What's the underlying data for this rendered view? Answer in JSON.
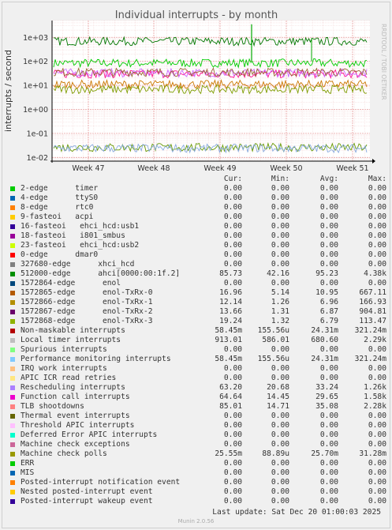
{
  "chart_data": {
    "type": "line",
    "title": "Individual interrupts - by month",
    "ylabel": "interrupts / second",
    "yscale": "log",
    "ylim": [
      0.007,
      5000
    ],
    "yticks": [
      "1e-02",
      "1e-01",
      "1e+00",
      "1e+01",
      "1e+02",
      "1e+03"
    ],
    "xticks": [
      "Week 47",
      "Week 48",
      "Week 49",
      "Week 50",
      "Week 51"
    ],
    "grid": true,
    "series": [
      {
        "name": "512000-edge ahci[0000:00:1f.2]",
        "color": "#00cc00",
        "level": 85
      },
      {
        "name": "Local timer interrupts",
        "color": "#007700",
        "level": 680
      },
      {
        "name": "Function call interrupts",
        "color": "#ff1493",
        "level": 30
      },
      {
        "name": "Rescheduling interrupts",
        "color": "#cc66ff",
        "level": 33
      },
      {
        "name": "TLB shootdowns",
        "color": "#996633",
        "level": 35
      },
      {
        "name": "1572865-edge enol-TxRx-0",
        "color": "#cc7700",
        "level": 11
      },
      {
        "name": "1572868-edge enol-TxRx-3",
        "color": "#7e9d00",
        "level": 6.8
      },
      {
        "name": "Machine check polls",
        "color": "#669900",
        "level": 0.026
      },
      {
        "name": "Performance monitoring interrupts",
        "color": "#88aadd",
        "level": 0.024
      }
    ]
  },
  "watermark": "RRDTOOL / TOBI OETIKER",
  "legend_headers": {
    "cur": "Cur:",
    "min": "Min:",
    "avg": "Avg:",
    "max": "Max:"
  },
  "legend": [
    {
      "name": "2-edge      timer",
      "color": "#00cc00",
      "cur": "0.00",
      "min": "0.00",
      "avg": "0.00",
      "max": "0.00"
    },
    {
      "name": "4-edge      ttyS0",
      "color": "#0066b3",
      "cur": "0.00",
      "min": "0.00",
      "avg": "0.00",
      "max": "0.00"
    },
    {
      "name": "8-edge      rtc0",
      "color": "#ff8000",
      "cur": "0.00",
      "min": "0.00",
      "avg": "0.00",
      "max": "0.00"
    },
    {
      "name": "9-fasteoi   acpi",
      "color": "#ffcc00",
      "cur": "0.00",
      "min": "0.00",
      "avg": "0.00",
      "max": "0.00"
    },
    {
      "name": "16-fasteoi   ehci_hcd:usb1",
      "color": "#330099",
      "cur": "0.00",
      "min": "0.00",
      "avg": "0.00",
      "max": "0.00"
    },
    {
      "name": "18-fasteoi   i801_smbus",
      "color": "#990099",
      "cur": "0.00",
      "min": "0.00",
      "avg": "0.00",
      "max": "0.00"
    },
    {
      "name": "23-fasteoi   ehci_hcd:usb2",
      "color": "#ccff00",
      "cur": "0.00",
      "min": "0.00",
      "avg": "0.00",
      "max": "0.00"
    },
    {
      "name": "0-edge      dmar0",
      "color": "#ff0000",
      "cur": "0.00",
      "min": "0.00",
      "avg": "0.00",
      "max": "0.00"
    },
    {
      "name": "327680-edge      xhci_hcd",
      "color": "#808080",
      "cur": "0.00",
      "min": "0.00",
      "avg": "0.00",
      "max": "0.00"
    },
    {
      "name": "512000-edge      ahci[0000:00:1f.2]",
      "color": "#008f00",
      "cur": "85.73",
      "min": "42.16",
      "avg": "95.23",
      "max": "4.38k"
    },
    {
      "name": "1572864-edge      enol",
      "color": "#00487d",
      "cur": "0.00",
      "min": "0.00",
      "avg": "0.00",
      "max": "0.00"
    },
    {
      "name": "1572865-edge      enol-TxRx-0",
      "color": "#b35a00",
      "cur": "16.96",
      "min": "5.14",
      "avg": "10.95",
      "max": "667.11"
    },
    {
      "name": "1572866-edge      enol-TxRx-1",
      "color": "#b38f00",
      "cur": "12.14",
      "min": "1.26",
      "avg": "6.96",
      "max": "166.93"
    },
    {
      "name": "1572867-edge      enol-TxRx-2",
      "color": "#6b006b",
      "cur": "13.66",
      "min": "1.31",
      "avg": "6.87",
      "max": "904.81"
    },
    {
      "name": "1572868-edge      enol-TxRx-3",
      "color": "#8fb300",
      "cur": "19.24",
      "min": "1.32",
      "avg": "6.79",
      "max": "113.47"
    },
    {
      "name": "Non-maskable interrupts",
      "color": "#b30000",
      "cur": "58.45m",
      "min": "155.56u",
      "avg": "24.31m",
      "max": "321.24m"
    },
    {
      "name": "Local timer interrupts",
      "color": "#bebebe",
      "cur": "913.01",
      "min": "586.01",
      "avg": "680.60",
      "max": "2.29k"
    },
    {
      "name": "Spurious interrupts",
      "color": "#80ff80",
      "cur": "0.00",
      "min": "0.00",
      "avg": "0.00",
      "max": "0.00"
    },
    {
      "name": "Performance monitoring interrupts",
      "color": "#80c9ff",
      "cur": "58.45m",
      "min": "155.56u",
      "avg": "24.31m",
      "max": "321.24m"
    },
    {
      "name": "IRQ work interrupts",
      "color": "#ffc080",
      "cur": "0.00",
      "min": "0.00",
      "avg": "0.00",
      "max": "0.00"
    },
    {
      "name": "APIC ICR read retries",
      "color": "#ffe680",
      "cur": "0.00",
      "min": "0.00",
      "avg": "0.00",
      "max": "0.00"
    },
    {
      "name": "Rescheduling interrupts",
      "color": "#aa80ff",
      "cur": "63.20",
      "min": "20.68",
      "avg": "33.24",
      "max": "1.26k"
    },
    {
      "name": "Function call interrupts",
      "color": "#ee00cc",
      "cur": "64.64",
      "min": "14.45",
      "avg": "29.65",
      "max": "1.58k"
    },
    {
      "name": "TLB shootdowns",
      "color": "#ff8080",
      "cur": "85.01",
      "min": "14.71",
      "avg": "35.08",
      "max": "2.28k"
    },
    {
      "name": "Thermal event interrupts",
      "color": "#666600",
      "cur": "0.00",
      "min": "0.00",
      "avg": "0.00",
      "max": "0.00"
    },
    {
      "name": "Threshold APIC interrupts",
      "color": "#ffbfff",
      "cur": "0.00",
      "min": "0.00",
      "avg": "0.00",
      "max": "0.00"
    },
    {
      "name": "Deferred Error APIC interrupts",
      "color": "#00ffcc",
      "cur": "0.00",
      "min": "0.00",
      "avg": "0.00",
      "max": "0.00"
    },
    {
      "name": "Machine check exceptions",
      "color": "#cc6699",
      "cur": "0.00",
      "min": "0.00",
      "avg": "0.00",
      "max": "0.00"
    },
    {
      "name": "Machine check polls",
      "color": "#999900",
      "cur": "25.55m",
      "min": "88.89u",
      "avg": "25.70m",
      "max": "31.28m"
    },
    {
      "name": "ERR",
      "color": "#00cc00",
      "cur": "0.00",
      "min": "0.00",
      "avg": "0.00",
      "max": "0.00"
    },
    {
      "name": "MIS",
      "color": "#0066b3",
      "cur": "0.00",
      "min": "0.00",
      "avg": "0.00",
      "max": "0.00"
    },
    {
      "name": "Posted-interrupt notification event",
      "color": "#ff8000",
      "cur": "0.00",
      "min": "0.00",
      "avg": "0.00",
      "max": "0.00"
    },
    {
      "name": "Nested posted-interrupt event",
      "color": "#ffcc00",
      "cur": "0.00",
      "min": "0.00",
      "avg": "0.00",
      "max": "0.00"
    },
    {
      "name": "Posted-interrupt wakeup event",
      "color": "#330099",
      "cur": "0.00",
      "min": "0.00",
      "avg": "0.00",
      "max": "0.00"
    }
  ],
  "last_update": "Last update: Sat Dec 20 01:00:03 2025",
  "footer": "Munin 2.0.56"
}
